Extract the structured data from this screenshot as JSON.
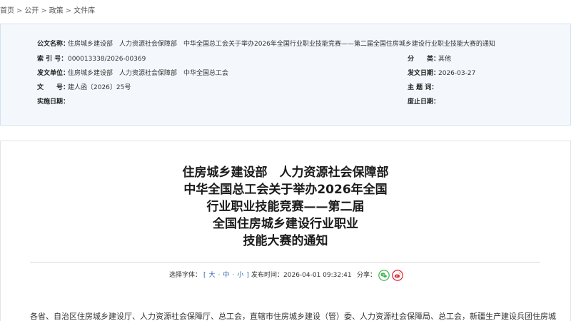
{
  "breadcrumb": {
    "items": [
      "首页",
      "公开",
      "政策",
      "文件库"
    ],
    "separator": ">"
  },
  "meta": {
    "doc_name": {
      "label": "公文名称：",
      "value": "住房城乡建设部　人力资源社会保障部　中华全国总工会关于举办2026年全国行业职业技能竞赛——第二届全国住房城乡建设行业职业技能大赛的通知"
    },
    "index_no": {
      "label": "索 引 号：",
      "value": "000013338/2026-00369"
    },
    "category": {
      "label": "分　　类：",
      "value": "其他"
    },
    "issuer": {
      "label": "发文单位：",
      "value": "住房城乡建设部　人力资源社会保障部　中华全国总工会"
    },
    "issue_date": {
      "label": "发文日期：",
      "value": "2026-03-27"
    },
    "doc_no": {
      "label": "文　　号：",
      "value": "建人函〔2026〕25号"
    },
    "subject_words": {
      "label": "主 题 词："
    },
    "effective_date": {
      "label": "实施日期："
    },
    "expiry_date": {
      "label": "废止日期："
    }
  },
  "article": {
    "title_lines": [
      "住房城乡建设部　人力资源社会保障部",
      "中华全国总工会关于举办2026年全国",
      "行业职业技能竞赛——第二届",
      "全国住房城乡建设行业职业",
      "技能大赛的通知"
    ],
    "font_size": {
      "label": "选择字体：",
      "open": "[",
      "options": [
        "大",
        "中",
        "小"
      ],
      "separator": "·",
      "close": "]"
    },
    "publish": {
      "label": "发布时间：",
      "value": "2026-04-01 09:32:41"
    },
    "share": {
      "label": "分享：",
      "wechat_icon": "wechat-icon",
      "weibo_icon": "weibo-icon"
    },
    "body_first_line": "各省、自治区住房城乡建设厅、人力资源社会保障厅、总工会，直辖市住房城乡建设（管）委、人力资源社会保障局、总工会，新疆生产建设兵团住房城"
  },
  "colors": {
    "link": "#2a64b0",
    "meta_background": "#f4f8fd",
    "meta_border": "#d3e1f0",
    "wechat": "#3fb34f",
    "weibo": "#e6162d"
  }
}
